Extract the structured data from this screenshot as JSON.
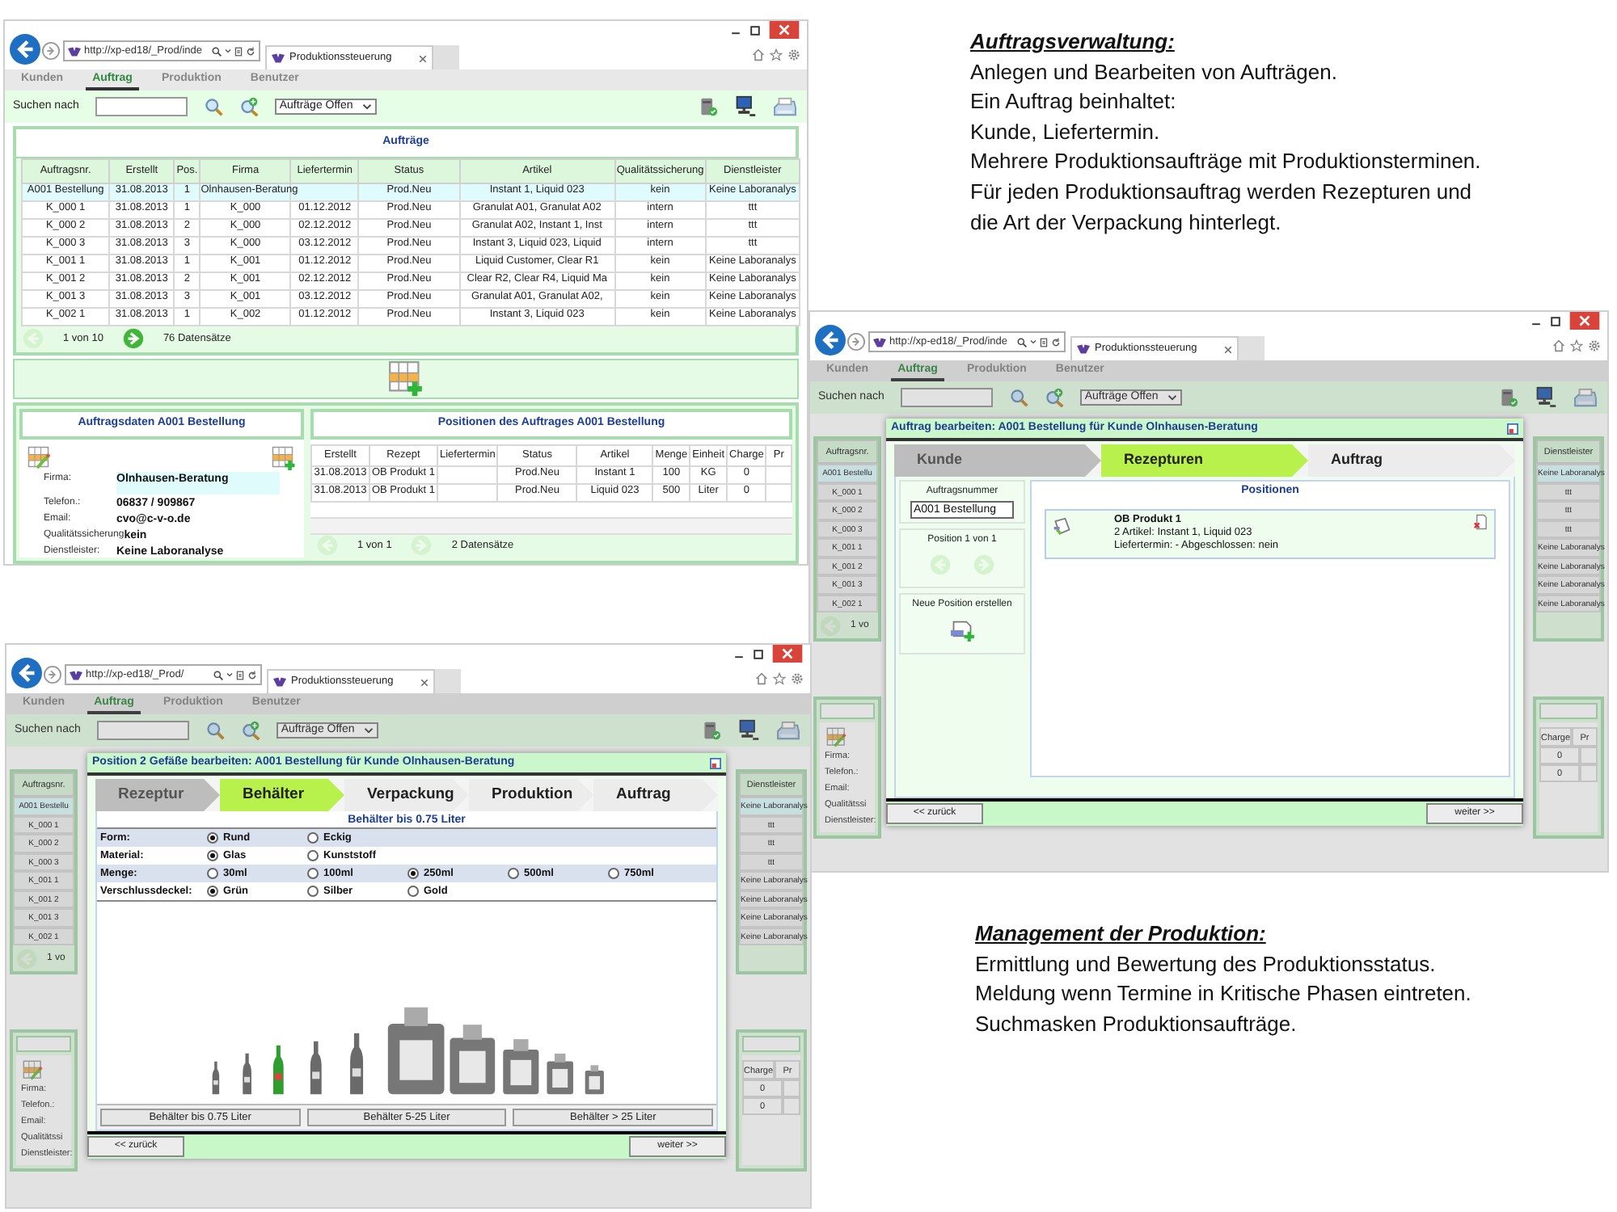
{
  "notes": [
    {
      "title": "Auftragsverwaltung:",
      "lines": [
        "Anlegen und Bearbeiten von Aufträgen.",
        "Ein Auftrag beinhaltet:",
        "Kunde, Liefertermin.",
        "Mehrere Produktionsaufträge mit Produktionsterminen.",
        "Für jeden Produktionsauftrag werden Rezepturen und",
        "die Art der Verpackung hinterlegt."
      ]
    },
    {
      "title": "Management der Produktion:",
      "lines": [
        "Ermittlung und Bewertung des Produktionsstatus.",
        "Meldung wenn Termine in Kritische Phasen eintreten.",
        "Suchmasken Produktionsaufträge."
      ]
    }
  ],
  "screens": [
    {
      "kind": "orders",
      "browser": {
        "url": "http://xp-ed18/_Prod/inde",
        "tab": "Produktionssteuerung"
      },
      "nav_tabs": [
        {
          "label": "Kunden",
          "selected": false
        },
        {
          "label": "Auftrag",
          "selected": true
        },
        {
          "label": "Produktion",
          "selected": false
        },
        {
          "label": "Benutzer",
          "selected": false
        }
      ],
      "search": {
        "label": "Suchen nach",
        "filter": "Aufträge Offen"
      },
      "orders": {
        "title": "Aufträge",
        "columns": [
          "Auftragsnr.",
          "Erstellt",
          "Pos.",
          "Firma",
          "Liefertermin",
          "Status",
          "Artikel",
          "Qualitätssicherung",
          "Dienstleister"
        ],
        "rows": [
          {
            "selected": true,
            "cells": [
              "A001 Bestellung",
              "31.08.2013",
              "1",
              "Olnhausen-Beratung",
              null,
              "Prod.Neu",
              "Instant 1, Liquid 023",
              "kein",
              "Keine Laboranalys"
            ]
          },
          {
            "selected": false,
            "cells": [
              "K_000 1",
              "31.08.2013",
              "1",
              "K_000",
              "01.12.2012",
              "Prod.Neu",
              "Granulat A01, Granulat A02",
              "intern",
              "ttt"
            ]
          },
          {
            "selected": false,
            "cells": [
              "K_000 2",
              "31.08.2013",
              "2",
              "K_000",
              "02.12.2012",
              "Prod.Neu",
              "Granulat A02, Instant 1, Inst",
              "intern",
              "ttt"
            ]
          },
          {
            "selected": false,
            "cells": [
              "K_000 3",
              "31.08.2013",
              "3",
              "K_000",
              "03.12.2012",
              "Prod.Neu",
              "Instant 3, Liquid 023, Liquid",
              "intern",
              "ttt"
            ]
          },
          {
            "selected": false,
            "cells": [
              "K_001 1",
              "31.08.2013",
              "1",
              "K_001",
              "01.12.2012",
              "Prod.Neu",
              "Liquid Customer, Clear R1",
              "kein",
              "Keine Laboranalys"
            ]
          },
          {
            "selected": false,
            "cells": [
              "K_001 2",
              "31.08.2013",
              "2",
              "K_001",
              "02.12.2012",
              "Prod.Neu",
              "Clear R2, Clear R4, Liquid Ma",
              "kein",
              "Keine Laboranalys"
            ]
          },
          {
            "selected": false,
            "cells": [
              "K_001 3",
              "31.08.2013",
              "3",
              "K_001",
              "03.12.2012",
              "Prod.Neu",
              "Granulat A01, Granulat A02,",
              "kein",
              "Keine Laboranalys"
            ]
          },
          {
            "selected": false,
            "cells": [
              "K_002 1",
              "31.08.2013",
              "1",
              "K_002",
              "01.12.2012",
              "Prod.Neu",
              "Instant 3, Liquid 023",
              "kein",
              "Keine Laboranalys"
            ]
          }
        ],
        "pager": {
          "page": "1 von 10",
          "count": "76 Datensätze",
          "prev_disabled": true,
          "next_disabled": false
        }
      },
      "details": {
        "title": "Auftragsdaten A001 Bestellung",
        "fields": [
          {
            "label": "Firma:",
            "value": "Olnhausen-Beratung",
            "highlighted": true
          },
          {
            "label": "Telefon.:",
            "value": "06837 / 909867",
            "highlighted": false
          },
          {
            "label": "Email:",
            "value": "cvo@c-v-o.de",
            "highlighted": false
          },
          {
            "label": "Qualitätssicherung",
            "value": "kein",
            "highlighted": false
          },
          {
            "label": "Dienstleister:",
            "value": "Keine Laboranalyse",
            "highlighted": false
          }
        ]
      },
      "positions": {
        "title": "Positionen des Auftrages A001 Bestellung",
        "columns": [
          "Erstellt",
          "Rezept",
          "Liefertermin",
          "Status",
          "Artikel",
          "Menge",
          "Einheit",
          "Charge",
          "Pr"
        ],
        "rows": [
          [
            "31.08.2013",
            "OB Produkt 1",
            null,
            "Prod.Neu",
            "Instant 1",
            "100",
            "KG",
            "0",
            null
          ],
          [
            "31.08.2013",
            "OB Produkt 1",
            null,
            "Prod.Neu",
            "Liquid 023",
            "500",
            "Liter",
            "0",
            null
          ]
        ],
        "pager": {
          "page": "1 von 1",
          "count": "2 Datensätze",
          "prev_disabled": true,
          "next_disabled": true
        }
      }
    },
    {
      "kind": "order_dialog",
      "browser": {
        "url": "http://xp-ed18/_Prod/inde",
        "tab": "Produktionssteuerung"
      },
      "nav_tabs": [
        {
          "label": "Kunden",
          "selected": false
        },
        {
          "label": "Auftrag",
          "selected": true
        },
        {
          "label": "Produktion",
          "selected": false
        },
        {
          "label": "Benutzer",
          "selected": false
        }
      ],
      "search": {
        "label": "Suchen nach",
        "filter": "Aufträge Offen"
      },
      "background": {
        "left_header": "Auftragsnr.",
        "left_cells": [
          "A001 Bestellu",
          "K_000 1",
          "K_000 2",
          "K_000 3",
          "K_001 1",
          "K_001 2",
          "K_001 3",
          "K_002 1"
        ],
        "pager": "1 vo",
        "labels": [
          "Firma:",
          "Telefon.:",
          "Email:",
          "Qualitätssi",
          "Dienstleister:"
        ],
        "right_header": "Dienstleister",
        "right_cells": [
          "Keine Laboranalys",
          "ttt",
          "ttt",
          "ttt",
          "Keine Laboranalys",
          "Keine Laboranalys",
          "Keine Laboranalys",
          "Keine Laboranalys"
        ],
        "lower_columns": [
          "Charge",
          "Pr"
        ],
        "lower_values": [
          "0",
          "0"
        ]
      },
      "dialog": {
        "title": "Auftrag bearbeiten: A001 Bestellung für Kunde Olnhausen-Beratung",
        "steps": [
          {
            "label": "Kunde",
            "selected": false,
            "done": true
          },
          {
            "label": "Rezepturen",
            "selected": true,
            "done": false
          },
          {
            "label": "Auftrag",
            "selected": false,
            "done": false
          }
        ],
        "order_number": {
          "label": "Auftragsnummer",
          "value": "A001 Bestellung"
        },
        "position_nav": {
          "label": "Position 1 von 1",
          "prev_disabled": true,
          "next_disabled": true
        },
        "new_position": "Neue Position erstellen",
        "positions_title": "Positionen",
        "cards": [
          {
            "title": "OB Produkt 1",
            "lines": [
              "2 Artikel: Instant 1, Liquid 023",
              "Liefertermin: - Abgeschlossen: nein"
            ]
          }
        ],
        "back": "<< zurück",
        "next": "weiter >>"
      }
    },
    {
      "kind": "container_dialog",
      "browser": {
        "url": "http://xp-ed18/_Prod/",
        "tab": "Produktionssteuerung"
      },
      "nav_tabs": [
        {
          "label": "Kunden",
          "selected": false
        },
        {
          "label": "Auftrag",
          "selected": true
        },
        {
          "label": "Produktion",
          "selected": false
        },
        {
          "label": "Benutzer",
          "selected": false
        }
      ],
      "search": {
        "label": "Suchen nach",
        "filter": "Aufträge Offen"
      },
      "background": {
        "left_header": "Auftragsnr.",
        "left_cells": [
          "A001 Bestellu",
          "K_000 1",
          "K_000 2",
          "K_000 3",
          "K_001 1",
          "K_001 2",
          "K_001 3",
          "K_002 1"
        ],
        "pager": "1 vo",
        "labels": [
          "Firma:",
          "Telefon.:",
          "Email:",
          "Qualitätssi",
          "Dienstleister:"
        ],
        "right_header": "Dienstleister",
        "right_cells": [
          "Keine Laboranalys",
          "ttt",
          "ttt",
          "ttt",
          "Keine Laboranalys",
          "Keine Laboranalys",
          "Keine Laboranalys",
          "Keine Laboranalys"
        ],
        "lower_columns": [
          "Charge",
          "Pr"
        ],
        "lower_values": [
          "0",
          "0"
        ]
      },
      "dialog": {
        "title": "Position 2 Gefäße bearbeiten: A001 Bestellung für Kunde Olnhausen-Beratung",
        "steps": [
          {
            "label": "Rezeptur",
            "selected": false,
            "done": true
          },
          {
            "label": "Behälter",
            "selected": true,
            "done": false
          },
          {
            "label": "Verpackung",
            "selected": false,
            "done": false
          },
          {
            "label": "Produktion",
            "selected": false,
            "done": false
          },
          {
            "label": "Auftrag",
            "selected": false,
            "done": false
          }
        ],
        "section": "Behälter bis 0.75 Liter",
        "options": [
          {
            "label": "Form:",
            "choices": [
              {
                "label": "Rund",
                "selected": true
              },
              {
                "label": "Eckig",
                "selected": false
              }
            ]
          },
          {
            "label": "Material:",
            "choices": [
              {
                "label": "Glas",
                "selected": true
              },
              {
                "label": "Kunststoff",
                "selected": false
              }
            ]
          },
          {
            "label": "Menge:",
            "choices": [
              {
                "label": "30ml",
                "selected": false
              },
              {
                "label": "100ml",
                "selected": false
              },
              {
                "label": "250ml",
                "selected": true
              },
              {
                "label": "500ml",
                "selected": false
              },
              {
                "label": "750ml",
                "selected": false
              }
            ]
          },
          {
            "label": "Verschlussdeckel:",
            "choices": [
              {
                "label": "Grün",
                "selected": true
              },
              {
                "label": "Silber",
                "selected": false
              },
              {
                "label": "Gold",
                "selected": false
              }
            ]
          }
        ],
        "ranges": [
          "Behälter bis 0.75 Liter",
          "Behälter 5-25 Liter",
          "Behälter > 25 Liter"
        ],
        "back": "<< zurück",
        "next": "weiter >>"
      }
    }
  ]
}
